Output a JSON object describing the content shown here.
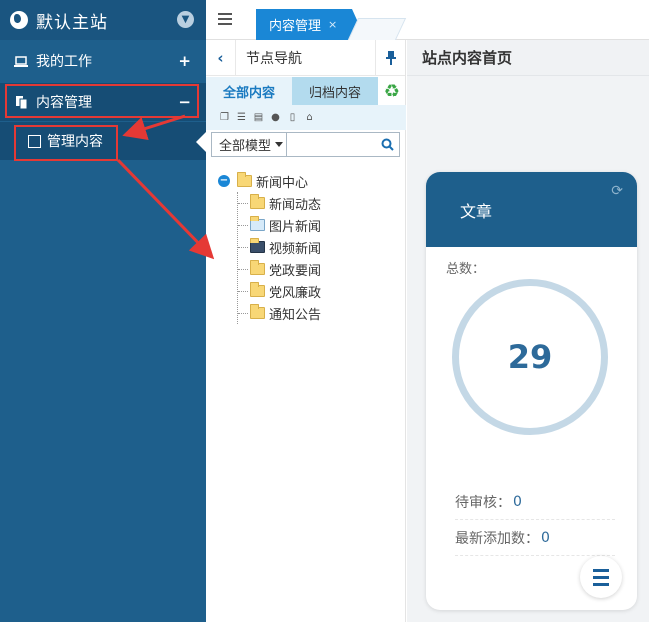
{
  "sidebar": {
    "site_title": "默认主站",
    "items": [
      {
        "label": "我的工作",
        "right": "+"
      },
      {
        "label": "内容管理",
        "right": "−"
      }
    ],
    "sub_item": {
      "label": "管理内容"
    }
  },
  "tabs": {
    "active_label": "内容管理",
    "close": "×"
  },
  "tree_panel": {
    "title": "节点导航",
    "tabs": {
      "all": "全部内容",
      "archive": "归档内容"
    },
    "filter": {
      "model": "全部模型",
      "search_placeholder": ""
    },
    "root": "新闻中心",
    "children": [
      "新闻动态",
      "图片新闻",
      "视频新闻",
      "党政要闻",
      "党风廉政",
      "通知公告"
    ]
  },
  "main": {
    "title": "站点内容首页",
    "card": {
      "title": "文章",
      "total_label": "总数：",
      "total": "29",
      "pending_label": "待审核：",
      "pending": "0",
      "new_label": "最新添加数：",
      "new": "0"
    }
  },
  "colors": {
    "sidebar": "#1e5f8c",
    "accent": "#1a87d6",
    "highlight": "#e53935"
  }
}
